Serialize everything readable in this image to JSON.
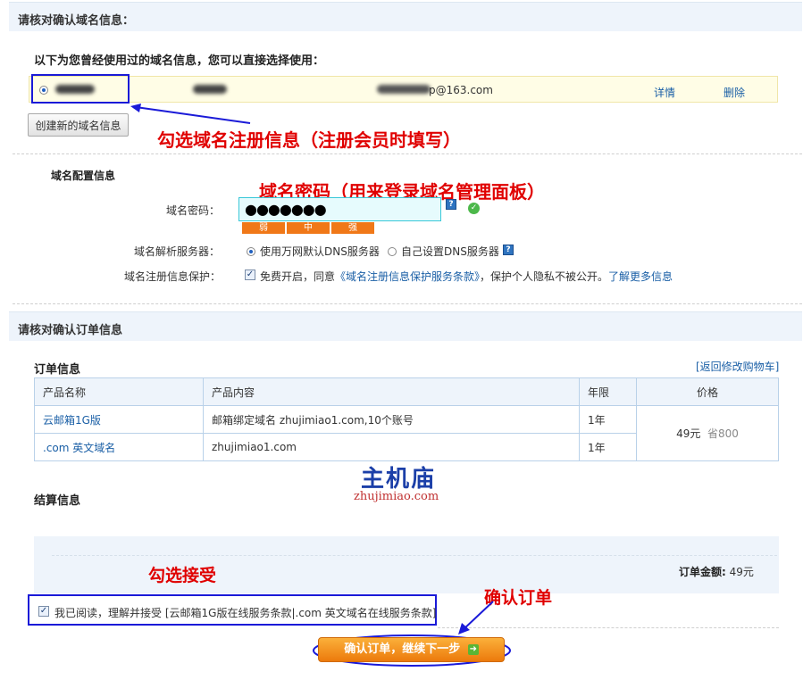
{
  "domain_section": {
    "title": "请核对确认域名信息：",
    "intro": "以下为您曾经使用过的域名信息，您可以直接选择使用：",
    "saved_record": {
      "name": "",
      "org": "",
      "email_tail": "p@163.com",
      "detail_link": "详情",
      "delete_link": "删除"
    },
    "create_new_button": "创建新的域名信息",
    "annotation_select": "勾选域名注册信息（注册会员时填写）"
  },
  "config": {
    "title": "域名配置信息",
    "password_label": "域名密码：",
    "password_value": "●●●●●●●",
    "annotation_password": "域名密码（用来登录域名管理面板）",
    "strength": [
      "弱",
      "中",
      "强"
    ],
    "dns_label": "域名解析服务器：",
    "dns_option_default": "使用万网默认DNS服务器",
    "dns_option_custom": "自己设置DNS服务器",
    "privacy_label": "域名注册信息保护：",
    "privacy_text_1": "免费开启，同意",
    "privacy_link": "《域名注册信息保护服务条款》",
    "privacy_text_2": "，保护个人隐私不被公开。",
    "privacy_more": "了解更多信息"
  },
  "order_section": {
    "title": "请核对确认订单信息",
    "order_info": "订单信息",
    "back_link": "[返回修改购物车]",
    "table": {
      "headers": [
        "产品名称",
        "产品内容",
        "年限",
        "价格"
      ],
      "rows": [
        {
          "name": "云邮箱1G版",
          "content": "邮箱绑定域名 zhujimiao1.com,10个账号",
          "years": "1年"
        },
        {
          "name": ".com 英文域名",
          "content": "zhujimiao1.com",
          "years": "1年"
        }
      ],
      "price": "49元",
      "saving": "省800"
    },
    "watermark_cn": "主机庙",
    "watermark_en": "zhujimiao.com",
    "settlement": "结算信息",
    "annotation_accept": "勾选接受",
    "total_label": "订单金额:",
    "total_value": "49元",
    "agree_text": "我已阅读，理解并接受",
    "agree_terms": "[云邮箱1G版在线服务条款|.com 英文域名在线服务条款]",
    "annotation_confirm": "确认订单",
    "confirm_button": "确认订单，继续下一步"
  },
  "colors": {
    "annotation": "#e00000",
    "highlight_box": "#1a1ad8",
    "link": "#1a5fa6",
    "strength_bar": "#f07818",
    "confirm_button": "#f08a10"
  }
}
